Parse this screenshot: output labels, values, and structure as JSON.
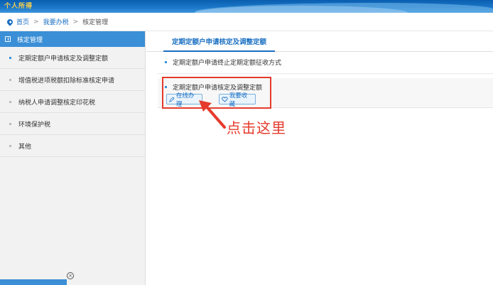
{
  "banner": {
    "logo": "个人所得"
  },
  "breadcrumb": {
    "home": "首页",
    "level2": "我要办税",
    "current": "核定管理",
    "sep": ">"
  },
  "sidebar": {
    "header": "核定管理",
    "items": [
      {
        "label": "定期定额户申请核定及调整定额",
        "active": true
      },
      {
        "label": "增值税进项税额扣除标准核定申请",
        "active": false
      },
      {
        "label": "纳税人申请调整核定印花税",
        "active": false
      },
      {
        "label": "环境保护税",
        "active": false
      },
      {
        "label": "其他",
        "active": false
      }
    ],
    "close_glyph": "×"
  },
  "main": {
    "tab": "定期定额户申请核定及调整定额",
    "row1": "定期定额户申请终止定期定额征收方式",
    "block_title": "定期定额户申请核定及调整定额",
    "btn_online": "在线办理",
    "btn_fav": "我要收藏"
  },
  "annotation": {
    "text": "点击这里",
    "color": "#e53b2c"
  },
  "colors": {
    "accent": "#1a6fc2",
    "sidebar_header": "#3a8fd6"
  }
}
